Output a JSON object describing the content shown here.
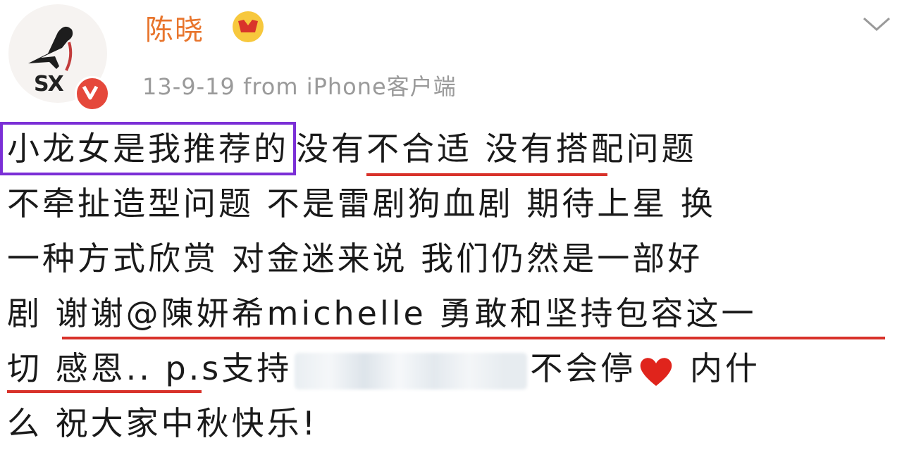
{
  "post": {
    "author": "陈晓",
    "avatar_text": "SX",
    "meta": "13-9-19  from iPhone客户端",
    "lines": [
      {
        "boxed": "小龙女是我推荐的",
        "rest": "没有不合适 没有搭配问题"
      },
      {
        "text": "不牵扯造型问题 不是雷剧狗血剧 期待上星 换"
      },
      {
        "text": "一种方式欣赏 对金迷来说 我们仍然是一部好"
      },
      {
        "text": "剧 谢谢@陳妍希michelle 勇敢和坚持包容这一"
      },
      {
        "before": "切 感恩.. p.s支持",
        "after": "不会停",
        "end": " 内什"
      },
      {
        "text": "么 祝大家中秋快乐!"
      }
    ]
  },
  "colors": {
    "username": "#e8752d",
    "meta": "#9a9a9a",
    "box": "#7b2fd6",
    "underline": "#d8322a",
    "heart": "#e0241c"
  },
  "icons": {
    "verified": "verified-v-icon",
    "vip": "vip-crown-icon",
    "menu": "chevron-down-icon",
    "heart": "red-heart-icon"
  }
}
